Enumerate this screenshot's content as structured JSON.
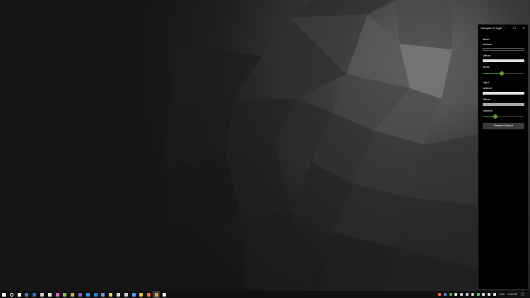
{
  "window": {
    "title": "Triangles JS Light",
    "minimize_glyph": "─",
    "maximize_glyph": "☐",
    "close_glyph": "✕",
    "mesh": {
      "section_label": "Mesh",
      "ambient_label": "Ambient",
      "ambient_color": "#000000",
      "diffuse_label": "Diffuse",
      "diffuse_color": "#dcdcdc",
      "slices_label": "Slices",
      "slices_fraction": 0.45
    },
    "light": {
      "section_label": "Light",
      "ambient_label": "Ambient",
      "ambient_color": "#e0e0e0",
      "diffuse_label": "Diffuse",
      "diffuse_color": "#a8a8a8",
      "distance_label": "Distance",
      "distance_fraction": 0.3
    },
    "restore_button": "Restore Default"
  },
  "taskbar": {
    "icons": [
      {
        "name": "start-icon",
        "color": "#ffffff"
      },
      {
        "name": "search-icon",
        "color": "#ffffff"
      },
      {
        "name": "task-view-icon",
        "color": "#ffffff"
      },
      {
        "name": "todo-icon",
        "color": "#2f7de1"
      },
      {
        "name": "mail-icon",
        "color": "#1e73c8"
      },
      {
        "name": "file-explorer-icon",
        "color": "#cfcfcf"
      },
      {
        "name": "store-icon",
        "color": "#e8e8e8"
      },
      {
        "name": "media-icon",
        "color": "#d46ad6"
      },
      {
        "name": "green-app-icon",
        "color": "#7cc34a"
      },
      {
        "name": "photos-icon",
        "color": "#e0a848"
      },
      {
        "name": "purple-app-icon",
        "color": "#9b52d6"
      },
      {
        "name": "terminal-icon",
        "color": "#2aa2d8"
      },
      {
        "name": "code-icon",
        "color": "#1e88d8"
      },
      {
        "name": "calculator-icon",
        "color": "#5aa0e8"
      },
      {
        "name": "chrome-icon",
        "color": "#e8d24a"
      },
      {
        "name": "settings-icon",
        "color": "#dcdcdc"
      },
      {
        "name": "network-app-icon",
        "color": "#cfcfcf"
      },
      {
        "name": "blue-app-icon",
        "color": "#4aa8ff"
      },
      {
        "name": "folder-icon",
        "color": "#f0c040"
      },
      {
        "name": "firefox-icon",
        "color": "#ff7a2a"
      },
      {
        "name": "orange-app-icon",
        "color": "#f09a40"
      },
      {
        "name": "active-app-icon",
        "color": "#e8e8e8"
      }
    ],
    "tray_icons": [
      {
        "name": "tray-orange-icon",
        "color": "#e07030"
      },
      {
        "name": "tray-shield-icon",
        "color": "#3a8ad8"
      },
      {
        "name": "tray-check-icon",
        "color": "#4ab04a"
      },
      {
        "name": "tray-cloud-icon",
        "color": "#e0e0e0"
      },
      {
        "name": "tray-app-icon",
        "color": "#c8c8c8"
      },
      {
        "name": "tray-grid-icon",
        "color": "#c8c8c8"
      },
      {
        "name": "tray-monitor-icon",
        "color": "#c8c8c8"
      },
      {
        "name": "tray-green-icon",
        "color": "#4ac060"
      },
      {
        "name": "tray-battery-icon",
        "color": "#dcdcdc"
      },
      {
        "name": "tray-volume-icon",
        "color": "#dcdcdc"
      },
      {
        "name": "tray-wifi-icon",
        "color": "#dcdcdc"
      }
    ],
    "language": "ENG",
    "time": "8:38 PM",
    "notification_glyph": "▢"
  }
}
